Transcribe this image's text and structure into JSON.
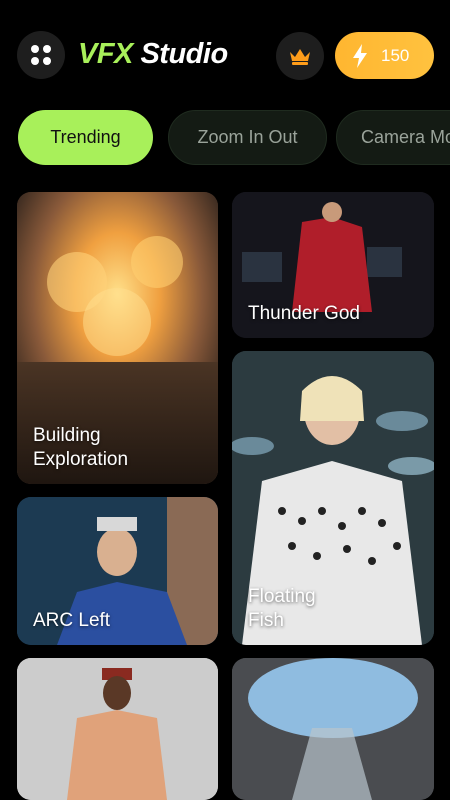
{
  "header": {
    "title_part1": "VFX",
    "title_part2": "Studio",
    "credits": "150",
    "menu_icon": "grid-dots-icon",
    "premium_icon": "crown-icon",
    "credits_icon": "lightning-icon"
  },
  "tabs": [
    {
      "label": "Trending",
      "active": true
    },
    {
      "label": "Zoom In Out",
      "active": false
    },
    {
      "label": "Camera Mo",
      "active": false
    }
  ],
  "cards": [
    {
      "label": "Building\nExploration"
    },
    {
      "label": "Thunder God"
    },
    {
      "label": "ARC Left"
    },
    {
      "label": "Floating\nFish"
    },
    {
      "label": ""
    },
    {
      "label": ""
    }
  ],
  "colors": {
    "accent": "#a8f05a",
    "credits": "#ffb630",
    "background": "#000000"
  }
}
